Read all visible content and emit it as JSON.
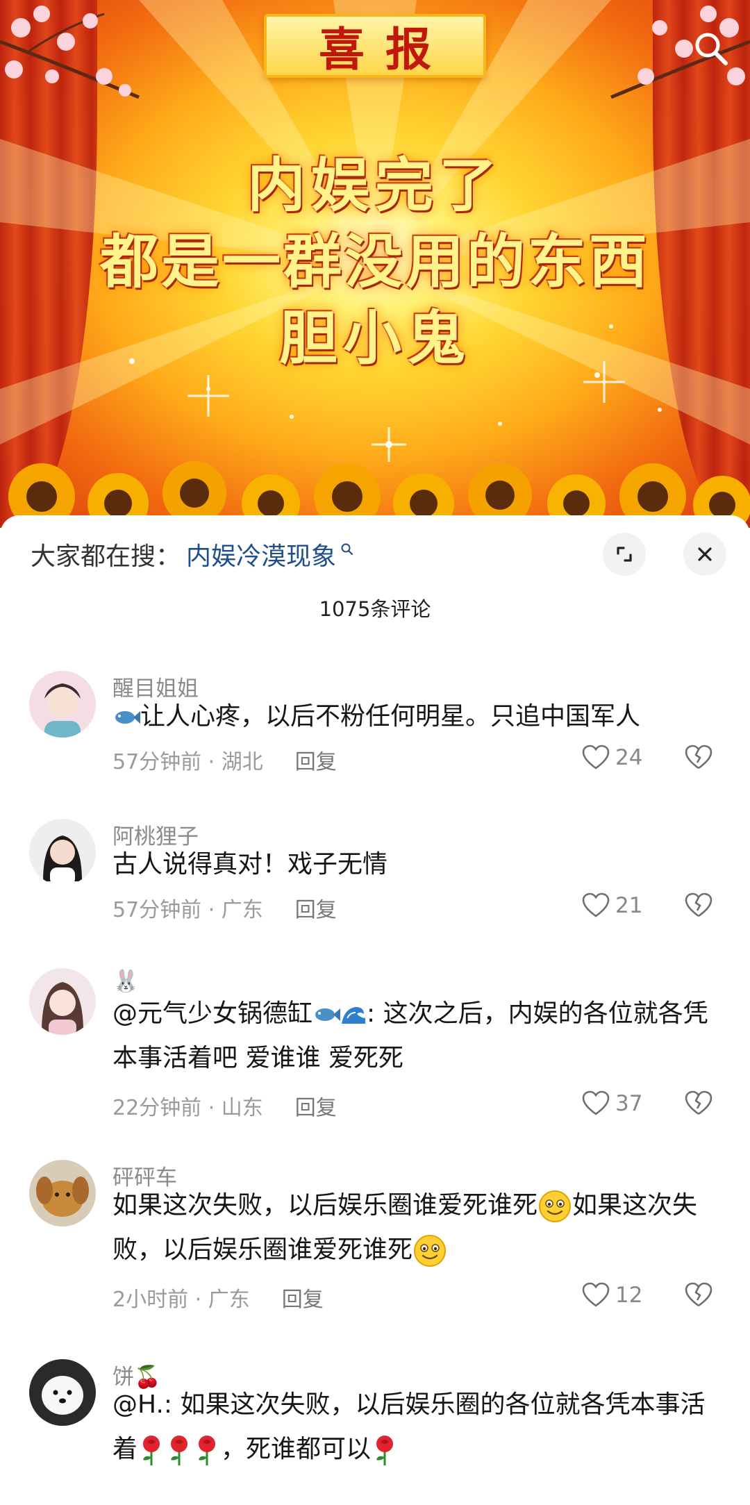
{
  "banner": {
    "plate": "喜报",
    "lines": [
      "内娱完了",
      "都是一群没用的东西",
      "胆小鬼"
    ]
  },
  "search": {
    "prefix": "大家都在搜：",
    "term": "内娱冷漠现象"
  },
  "comments_count_label": "1075条评论",
  "comments": [
    {
      "user": "醒目姐姐",
      "pre_emoji": "fish",
      "text": "让人心疼，以后不粉任何明星。只追中国军人",
      "time": "57分钟前 · 湖北",
      "reply": "回复",
      "likes": "24"
    },
    {
      "user": "阿桃狸子",
      "text": "古人说得真对！戏子无情",
      "time": "57分钟前 · 广东",
      "reply": "回复",
      "likes": "21"
    },
    {
      "user": "🐰",
      "mention": "@元气少女锅德缸",
      "mention_emojis": [
        "fish",
        "wave"
      ],
      "text": ": 这次之后，内娱的各位就各凭本事活着吧 爱谁谁 爱死死",
      "time": "22分钟前 · 山东",
      "reply": "回复",
      "likes": "37"
    },
    {
      "user": "砰砰车",
      "text_a": "如果这次失败，以后娱乐圈谁爱死谁死",
      "text_b": "如果这次失败，以后娱乐圈谁爱死谁死",
      "time": "2小时前 · 广东",
      "reply": "回复",
      "likes": "12"
    },
    {
      "user": "饼🍒",
      "text_a": "@H.: 如果这次失败，以后娱乐圈的各位就各凭本事活着",
      "text_b": "，死谁都可以"
    }
  ],
  "colors": {
    "accent_link": "#1f4e8c",
    "banner_red": "#d93a10",
    "banner_gold": "#ffd633"
  },
  "icons": {
    "search": "search-icon",
    "expand": "expand-icon",
    "close": "close-icon",
    "like": "heart-icon",
    "dislike": "broken-heart-icon"
  }
}
